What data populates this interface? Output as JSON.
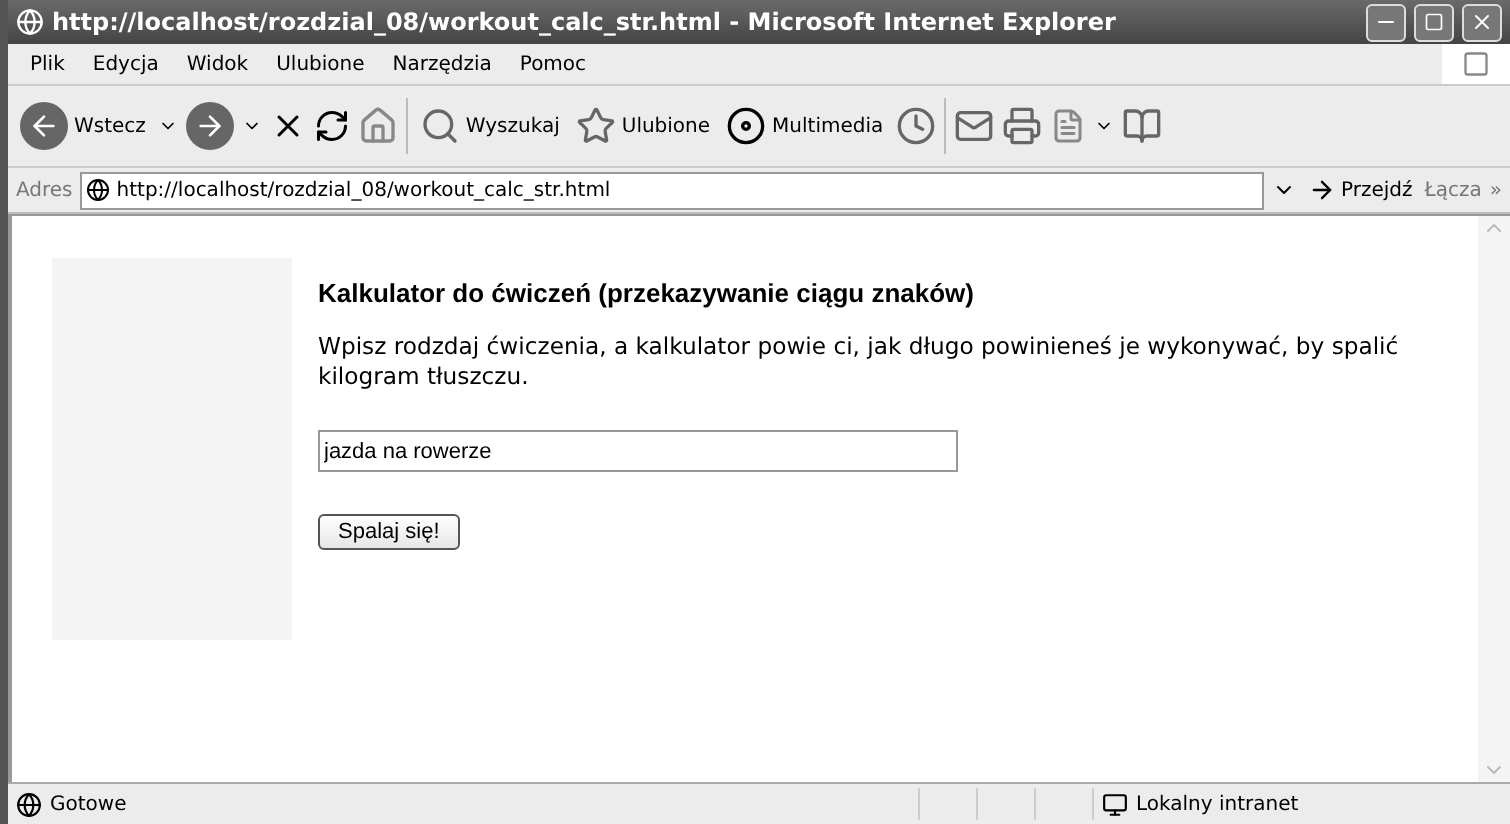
{
  "window": {
    "title": "http://localhost/rozdzial_08/workout_calc_str.html - Microsoft Internet Explorer"
  },
  "menu": [
    "Plik",
    "Edycja",
    "Widok",
    "Ulubione",
    "Narzędzia",
    "Pomoc"
  ],
  "toolbar": {
    "back": "Wstecz",
    "search": "Wyszukaj",
    "favorites": "Ulubione",
    "media": "Multimedia"
  },
  "address_bar": {
    "label": "Adres",
    "url": "http://localhost/rozdzial_08/workout_calc_str.html",
    "go": "Przejdź",
    "links": "Łącza",
    "more": "»"
  },
  "page": {
    "heading": "Kalkulator do ćwiczeń (przekazywanie ciągu znaków)",
    "description": "Wpisz rodzdaj ćwiczenia, a kalkulator powie ci, jak długo powinieneś je wykonywać, by spalić kilogram tłuszczu.",
    "input_value": "jazda na rowerze",
    "button": "Spalaj się!"
  },
  "status_bar": {
    "status": "Gotowe",
    "zone": "Lokalny intranet"
  }
}
